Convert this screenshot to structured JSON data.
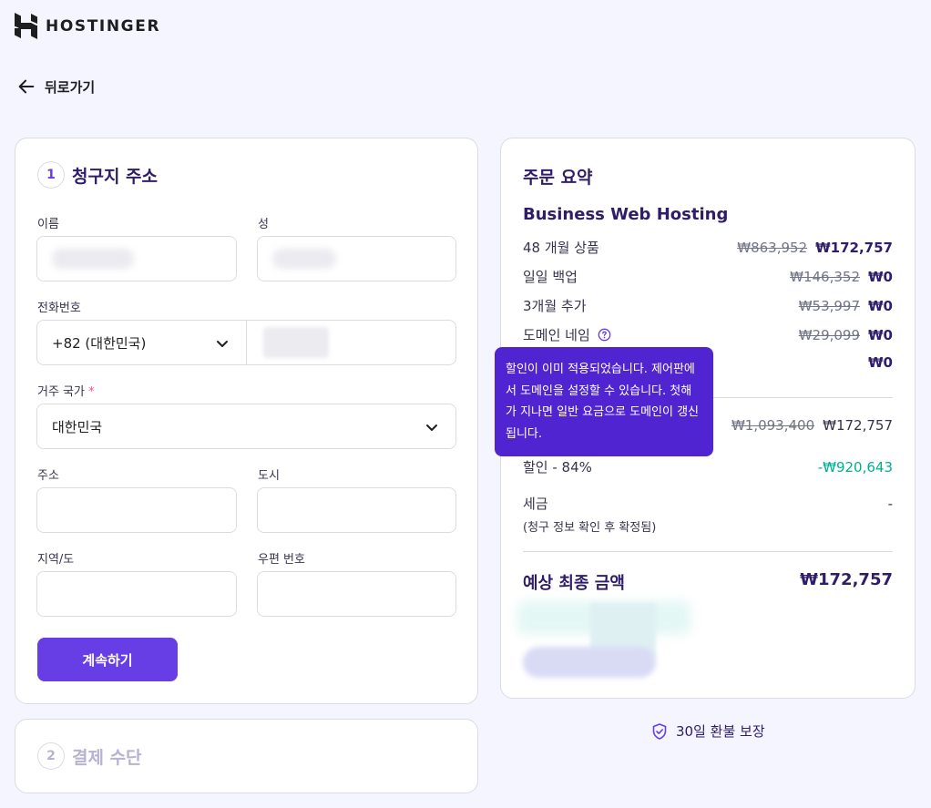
{
  "brand": {
    "name": "HOSTINGER"
  },
  "nav": {
    "back_label": "뒤로가기"
  },
  "billing": {
    "step": "1",
    "title": "청구지 주소",
    "first_name_label": "이름",
    "last_name_label": "성",
    "phone_label": "전화번호",
    "phone_country": "+82 (대한민국)",
    "country_label": "거주 국가",
    "required_mark": "*",
    "country_value": "대한민국",
    "address_label": "주소",
    "city_label": "도시",
    "region_label": "지역/도",
    "zip_label": "우편 번호",
    "continue_label": "계속하기"
  },
  "payment": {
    "step": "2",
    "title": "결제 수단"
  },
  "summary": {
    "title": "주문 요약",
    "plan": "Business Web Hosting",
    "items": [
      {
        "label": "48 개월 상품",
        "old": "₩863,952",
        "new": "₩172,757"
      },
      {
        "label": "일일 백업",
        "old": "₩146,352",
        "new": "₩0"
      },
      {
        "label": "3개월 추가",
        "old": "₩53,997",
        "new": "₩0"
      },
      {
        "label": "도메인 네임",
        "old": "₩29,099",
        "new": "₩0"
      },
      {
        "label": "",
        "old": "",
        "new": "₩0"
      }
    ],
    "subtotal": {
      "old": "₩1,093,400",
      "new": "₩172,757"
    },
    "discount_label": "할인 - 84%",
    "discount_value": "-₩920,643",
    "tax_label": "세금",
    "tax_value": "-",
    "tax_note": "(청구 정보 확인 후 확정됨)",
    "total_label": "예상 최종 금액",
    "total_value": "₩172,757"
  },
  "tooltip": {
    "text": "할인이 이미 적용되었습니다. 제어판에서 도메인을 설정할 수 있습니다. 첫해가 지나면 일반 요금으로 도메인이 갱신됩니다."
  },
  "guarantee": {
    "label": "30일 환불 보장"
  },
  "colors": {
    "accent": "#673de6",
    "tooltip": "#5025d1",
    "discount": "#00b090",
    "heading": "#2f1c6a"
  }
}
